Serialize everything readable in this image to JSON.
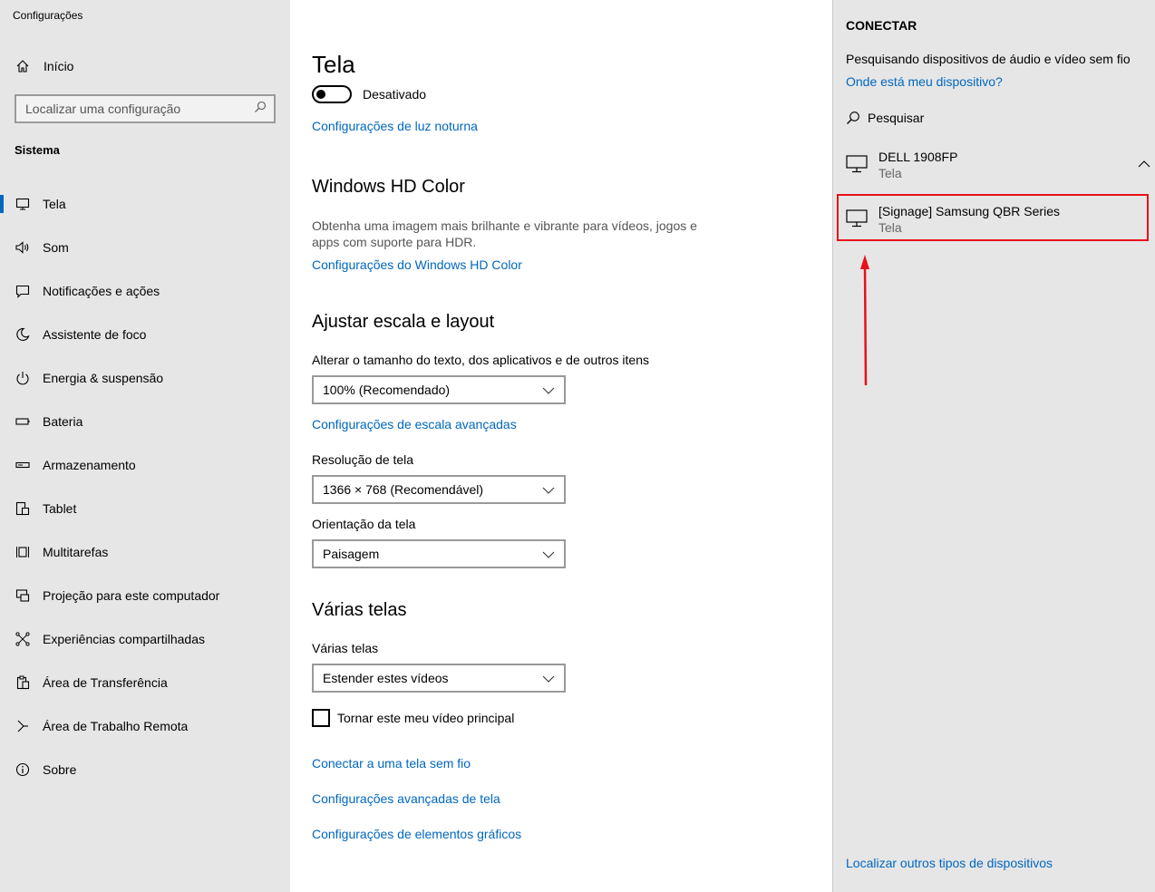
{
  "app_title": "Configurações",
  "sidebar": {
    "home_label": "Início",
    "search_placeholder": "Localizar uma configuração",
    "section_label": "Sistema",
    "items": [
      {
        "label": "Tela",
        "icon": "monitor-icon"
      },
      {
        "label": "Som",
        "icon": "speaker-icon"
      },
      {
        "label": "Notificações e ações",
        "icon": "notification-icon"
      },
      {
        "label": "Assistente de foco",
        "icon": "moon-icon"
      },
      {
        "label": "Energia & suspensão",
        "icon": "power-icon"
      },
      {
        "label": "Bateria",
        "icon": "battery-icon"
      },
      {
        "label": "Armazenamento",
        "icon": "storage-icon"
      },
      {
        "label": "Tablet",
        "icon": "tablet-icon"
      },
      {
        "label": "Multitarefas",
        "icon": "multitask-icon"
      },
      {
        "label": "Projeção para este computador",
        "icon": "projection-icon"
      },
      {
        "label": "Experiências compartilhadas",
        "icon": "shared-icon"
      },
      {
        "label": "Área de Transferência",
        "icon": "clipboard-icon"
      },
      {
        "label": "Área de Trabalho Remota",
        "icon": "remote-icon"
      },
      {
        "label": "Sobre",
        "icon": "info-icon"
      }
    ]
  },
  "main": {
    "title": "Tela",
    "night_light_state": "Desativado",
    "night_light_link": "Configurações de luz noturna",
    "hdr_heading": "Windows HD Color",
    "hdr_desc": "Obtenha uma imagem mais brilhante e vibrante para vídeos, jogos e apps com suporte para HDR.",
    "hdr_link": "Configurações do Windows HD Color",
    "scale_heading": "Ajustar escala e layout",
    "scale_label": "Alterar o tamanho do texto, dos aplicativos e de outros itens",
    "scale_value": "100% (Recomendado)",
    "scale_link": "Configurações de escala avançadas",
    "resolution_label": "Resolução de tela",
    "resolution_value": "1366 × 768 (Recomendável)",
    "orientation_label": "Orientação da tela",
    "orientation_value": "Paisagem",
    "multi_heading": "Várias telas",
    "multi_label": "Várias telas",
    "multi_value": "Estender estes vídeos",
    "main_display_label": "Tornar este meu vídeo principal",
    "link_wireless": "Conectar a uma tela sem fio",
    "link_advanced": "Configurações avançadas de tela",
    "link_graphics": "Configurações de elementos gráficos"
  },
  "connect": {
    "title": "CONECTAR",
    "status": "Pesquisando dispositivos de áudio e vídeo sem fio",
    "where_link": "Onde está meu dispositivo?",
    "search_label": "Pesquisar",
    "devices": [
      {
        "name": "DELL 1908FP",
        "type": "Tela"
      },
      {
        "name": "[Signage] Samsung QBR Series",
        "type": "Tela"
      }
    ],
    "find_other_link": "Localizar outros tipos de dispositivos"
  },
  "colors": {
    "accent": "#0067c0",
    "highlight": "#e8101a",
    "sidebar_bg": "#e6e6e6"
  }
}
